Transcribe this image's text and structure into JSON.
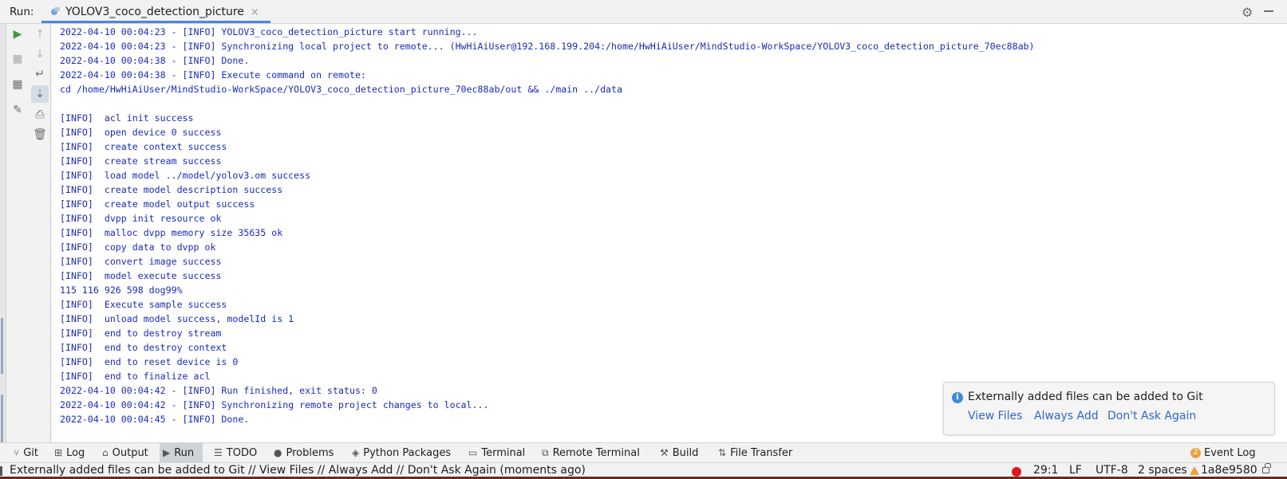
{
  "run_header": {
    "label": "Run:",
    "tab_title": "YOLOV3_coco_detection_picture",
    "tab_close": "×"
  },
  "console": {
    "lines": [
      "2022-04-10 00:04:23 - [INFO] YOLOV3_coco_detection_picture start running...",
      "2022-04-10 00:04:23 - [INFO] Synchronizing local project to remote... (HwHiAiUser@192.168.199.204:/home/HwHiAiUser/MindStudio-WorkSpace/YOLOV3_coco_detection_picture_70ec88ab)",
      "2022-04-10 00:04:38 - [INFO] Done.",
      "2022-04-10 00:04:38 - [INFO] Execute command on remote:",
      "cd /home/HwHiAiUser/MindStudio-WorkSpace/YOLOV3_coco_detection_picture_70ec88ab/out && ./main ../data",
      "",
      "[INFO]  acl init success",
      "[INFO]  open device 0 success",
      "[INFO]  create context success",
      "[INFO]  create stream success",
      "[INFO]  load model ../model/yolov3.om success",
      "[INFO]  create model description success",
      "[INFO]  create model output success",
      "[INFO]  dvpp init resource ok",
      "[INFO]  malloc dvpp memory size 35635 ok",
      "[INFO]  copy data to dvpp ok",
      "[INFO]  convert image success",
      "[INFO]  model execute success",
      "115 116 926 598 dog99%",
      "[INFO]  Execute sample success",
      "[INFO]  unload model success, modelId is 1",
      "[INFO]  end to destroy stream",
      "[INFO]  end to destroy context",
      "[INFO]  end to reset device is 0",
      "[INFO]  end to finalize acl",
      "2022-04-10 00:04:42 - [INFO] Run finished, exit status: 0",
      "2022-04-10 00:04:42 - [INFO] Synchronizing remote project changes to local...",
      "2022-04-10 00:04:45 - [INFO] Done."
    ]
  },
  "notification": {
    "icon": "info-icon",
    "icon_glyph": "i",
    "message": "Externally added files can be added to Git",
    "links": [
      "View Files",
      "Always Add",
      "Don't Ask Again"
    ]
  },
  "tool_windows": [
    {
      "label": "Git",
      "icon": "git-icon",
      "active": false
    },
    {
      "label": "Log",
      "icon": "log-icon",
      "active": false
    },
    {
      "label": "Output",
      "icon": "output-icon",
      "active": false
    },
    {
      "label": "Run",
      "icon": "run-icon",
      "active": true
    },
    {
      "label": "TODO",
      "icon": "todo-icon",
      "active": false
    },
    {
      "label": "Problems",
      "icon": "problems-icon",
      "active": false
    },
    {
      "label": "Python Packages",
      "icon": "packages-icon",
      "active": false
    },
    {
      "label": "Terminal",
      "icon": "terminal-icon",
      "active": false
    },
    {
      "label": "Remote Terminal",
      "icon": "remote-terminal-icon",
      "active": false
    },
    {
      "label": "Build",
      "icon": "build-icon",
      "active": false
    },
    {
      "label": "File Transfer",
      "icon": "file-transfer-icon",
      "active": false
    }
  ],
  "event_log": {
    "label": "Event Log",
    "count": "2"
  },
  "status_bar": {
    "message": "Externally added files can be added to Git // View Files // Always Add // Don't Ask Again (moments ago)",
    "position": "29:1",
    "line_separator": "LF",
    "encoding": "UTF-8",
    "indent": "2 spaces",
    "git_revision": "1a8e9580"
  },
  "colors": {
    "console_text": "#1a2cb5",
    "link": "#2f65ca",
    "tab_underline": "#4a86e8",
    "status_error_dot": "#e0161a"
  }
}
